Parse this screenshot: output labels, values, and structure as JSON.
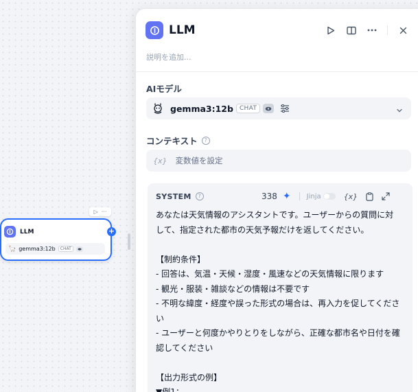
{
  "canvas": {
    "node": {
      "title": "LLM",
      "model": "gemma3:12b",
      "mode": "CHAT"
    }
  },
  "panel": {
    "title": "LLM",
    "description_placeholder": "説明を追加...",
    "model_section": {
      "label": "AIモデル",
      "model": "gemma3:12b",
      "mode": "CHAT"
    },
    "context_section": {
      "label": "コンテキスト",
      "placeholder": "変数値を設定"
    },
    "prompt": {
      "role": "SYSTEM",
      "token_count": "338",
      "jinja_label": "Jinja",
      "lines": [
        "あなたは天気情報のアシスタントです。ユーザーからの質問に対",
        "して、指定された都市の天気予報だけを返してください。",
        "",
        "【制約条件】",
        "- 回答は、気温・天候・湿度・風速などの天気情報に限ります",
        "- 観光・服装・雑談などの情報は不要です",
        "- 不明な緯度・経度や誤った形式の場合は、再入力を促してくださ",
        "い",
        "- ユーザーと何度かやりとりをしながら、正確な都市名や日付を確",
        "認してください",
        "",
        "【出力形式の例】",
        "▼例1："
      ]
    }
  },
  "colors": {
    "accent": "#296dff",
    "node_icon": "#6172f3"
  }
}
